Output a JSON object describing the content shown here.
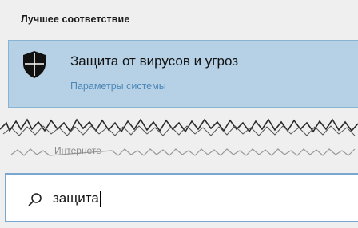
{
  "results": {
    "section_header": "Лучшее соответствие",
    "best_match": {
      "title": "Защита от вирусов и угроз",
      "subtitle": "Параметры системы",
      "icon": "shield-icon"
    },
    "blurred_item_label": "Интернете"
  },
  "search": {
    "query": "защита",
    "icon": "search-icon"
  },
  "colors": {
    "selection_bg": "#b6d1e6",
    "subtitle": "#4c87b8",
    "search_border": "#7aa6d0"
  }
}
